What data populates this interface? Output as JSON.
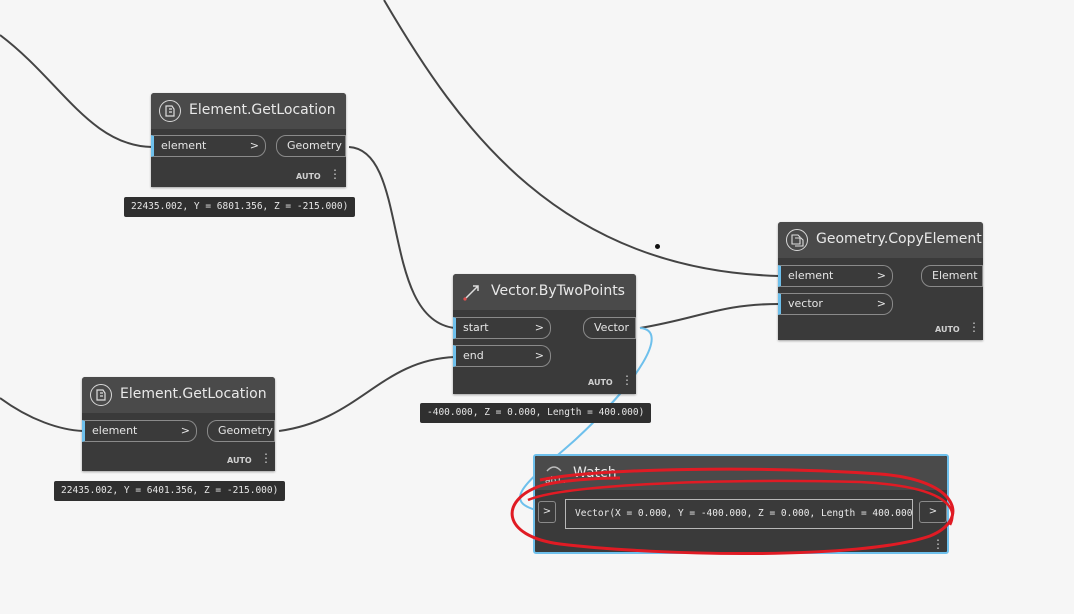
{
  "nodes": {
    "get_location_1": {
      "title": "Element.GetLocation",
      "input": "element",
      "output": "Geometry",
      "lacing": "AUTO",
      "preview": "22435.002, Y = 6801.356, Z = -215.000)"
    },
    "get_location_2": {
      "title": "Element.GetLocation",
      "input": "element",
      "output": "Geometry",
      "lacing": "AUTO",
      "preview": "22435.002, Y = 6401.356, Z = -215.000)"
    },
    "vector_by_two_points": {
      "title": "Vector.ByTwoPoints",
      "input_start": "start",
      "input_end": "end",
      "output": "Vector",
      "lacing": "AUTO",
      "preview": "-400.000, Z = 0.000, Length = 400.000)"
    },
    "copy_element": {
      "title": "Geometry.CopyElement",
      "input_element": "element",
      "input_vector": "vector",
      "output": "Element",
      "lacing": "AUTO"
    },
    "watch": {
      "title": "Watch",
      "value": "Vector(X = 0.000, Y = -400.000, Z = 0.000, Length = 400.000)"
    }
  },
  "chevron": ">",
  "icons": {
    "get_location": "element-location-icon",
    "vector": "vector-arrow-icon",
    "copy": "copy-element-icon",
    "watch": "watch-ab-icon",
    "menu": "vertical-dots-icon"
  },
  "colors": {
    "canvas": "#f6f6f6",
    "node_body": "#3a3a3a",
    "node_header": "#4a4a4a",
    "wire": "#444444",
    "selected_wire": "#6ec0ec",
    "annotation": "#e01b24"
  }
}
